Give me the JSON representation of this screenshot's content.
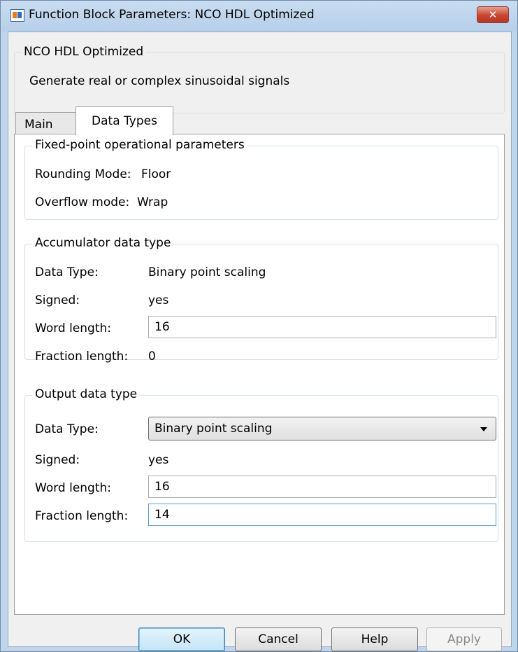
{
  "window": {
    "title": "Function Block Parameters: NCO HDL Optimized",
    "close_label": "✕"
  },
  "description": {
    "group_title": "NCO HDL Optimized",
    "text": "Generate real or complex sinusoidal signals"
  },
  "tabs": [
    {
      "label": "Main",
      "active": false
    },
    {
      "label": "Data Types",
      "active": true
    }
  ],
  "fixed_point": {
    "title": "Fixed-point operational parameters",
    "rounding_label": "Rounding Mode:",
    "rounding_value": "Floor",
    "overflow_label": "Overflow mode:",
    "overflow_value": "Wrap"
  },
  "accumulator": {
    "title": "Accumulator data type",
    "data_type_label": "Data Type:",
    "data_type_value": "Binary point scaling",
    "signed_label": "Signed:",
    "signed_value": "yes",
    "word_length_label": "Word length:",
    "word_length_value": "16",
    "fraction_length_label": "Fraction length:",
    "fraction_length_value": "0"
  },
  "output": {
    "title": "Output data type",
    "data_type_label": "Data Type:",
    "data_type_value": "Binary point scaling",
    "signed_label": "Signed:",
    "signed_value": "yes",
    "word_length_label": "Word length:",
    "word_length_value": "16",
    "fraction_length_label": "Fraction length:",
    "fraction_length_value": "14"
  },
  "buttons": {
    "ok": "OK",
    "cancel": "Cancel",
    "help": "Help",
    "apply": "Apply"
  },
  "colors": {
    "title_bar": "#bfd5ec",
    "close_button": "#c7432f",
    "focus_border": "#5b9bd5"
  }
}
